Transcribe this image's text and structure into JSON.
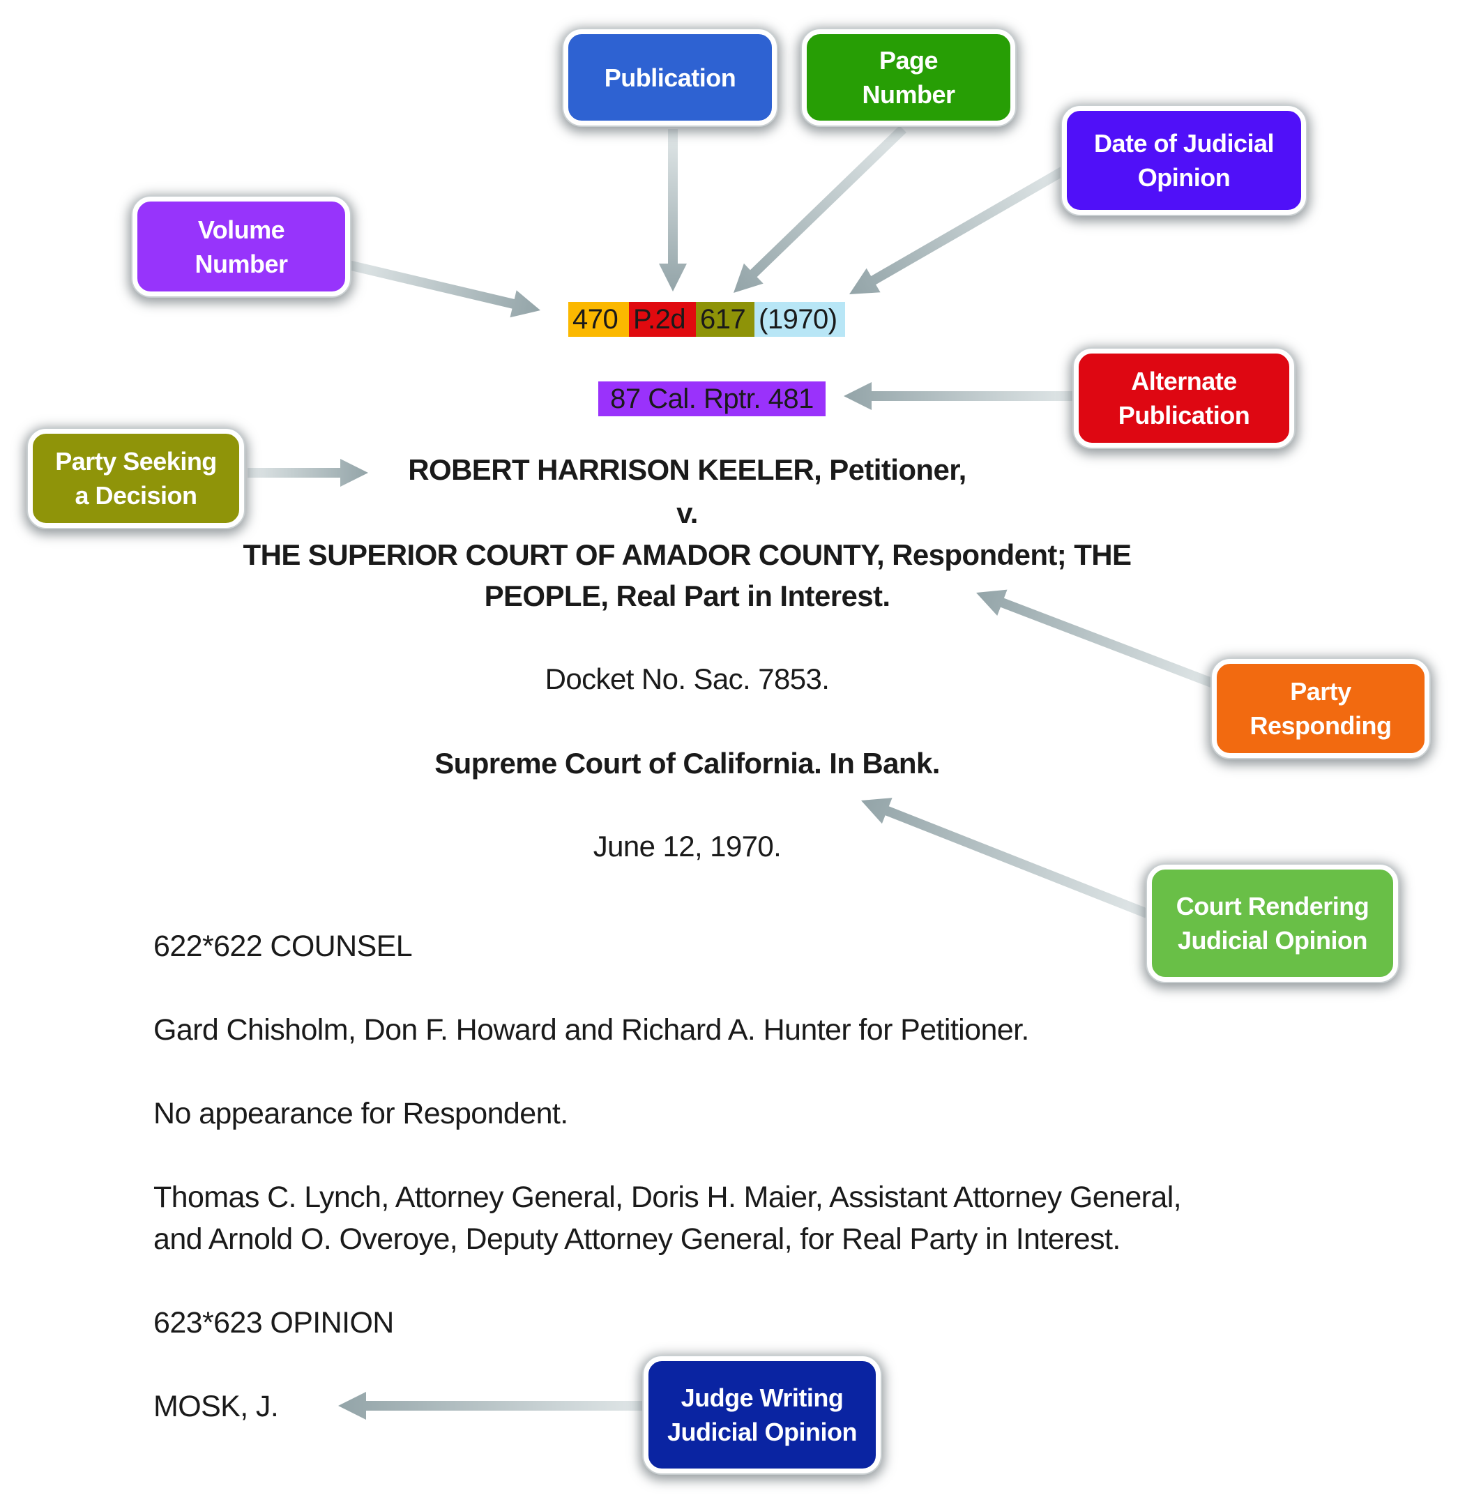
{
  "citation": {
    "segments": [
      {
        "text": "470",
        "role": "volume",
        "color": "#fbb800"
      },
      {
        "text": "P.2d",
        "role": "publication",
        "color": "#e00a0f"
      },
      {
        "text": "617",
        "role": "page",
        "color": "#8e9308"
      },
      {
        "text": "(1970)",
        "role": "date",
        "color": "#b8e6f6"
      }
    ],
    "alternate": {
      "text": "87 Cal. Rptr. 481",
      "color": "#9a32fb"
    }
  },
  "callouts": {
    "publication": {
      "label": "Publication",
      "color": "#2e62d2"
    },
    "page_number": {
      "label": "Page\nNumber",
      "color": "#279e05"
    },
    "date": {
      "label": "Date of Judicial\nOpinion",
      "color": "#5010f8"
    },
    "volume": {
      "label": "Volume\nNumber",
      "color": "#9734fb"
    },
    "alternate": {
      "label": "Alternate\nPublication",
      "color": "#de0712"
    },
    "party_seeking": {
      "label": "Party Seeking\na Decision",
      "color": "#8f9409"
    },
    "party_responding": {
      "label": "Party\nResponding",
      "color": "#f26a10"
    },
    "court": {
      "label": "Court Rendering\nJudicial Opinion",
      "color": "#69bf47"
    },
    "judge": {
      "label": "Judge Writing\nJudicial Opinion",
      "color": "#0a24a2"
    }
  },
  "document": {
    "caption_line1": "ROBERT HARRISON KEELER, Petitioner,",
    "caption_v": "v.",
    "caption_line3": "THE SUPERIOR COURT OF AMADOR COUNTY, Respondent; THE",
    "caption_line4": "PEOPLE, Real Part in Interest.",
    "docket": "Docket No. Sac. 7853.",
    "court": "Supreme Court of California. In Bank.",
    "date": "June 12, 1970.",
    "counsel_heading": "622*622 COUNSEL",
    "counsel_petitioner": "Gard Chisholm, Don F. Howard and Richard A. Hunter for Petitioner.",
    "counsel_respondent": "No appearance for Respondent.",
    "counsel_real_party_1": "Thomas C. Lynch, Attorney General, Doris H. Maier, Assistant Attorney General,",
    "counsel_real_party_2": "and Arnold O. Overoye, Deputy Attorney General, for Real Party in Interest.",
    "opinion_heading": "623*623 OPINION",
    "judge": "MOSK, J."
  },
  "arrow_color": "#93a4a8"
}
